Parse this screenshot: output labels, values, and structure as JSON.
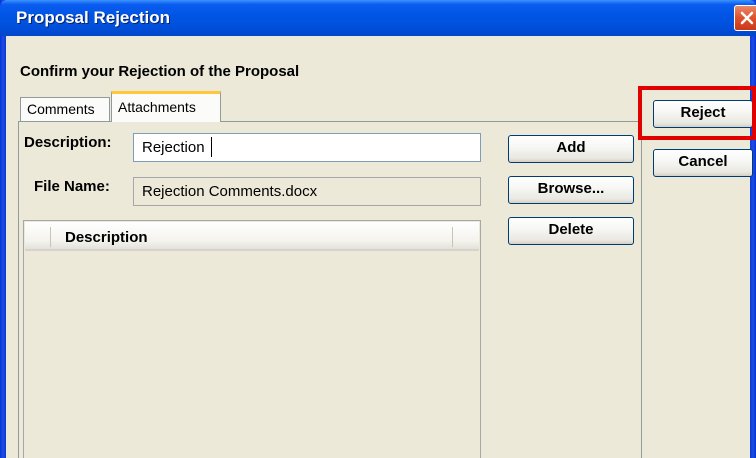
{
  "window": {
    "title": "Proposal Rejection",
    "heading": "Confirm your Rejection of the Proposal",
    "close_icon": "close-icon",
    "title_color": "#0054e3"
  },
  "tabs": [
    {
      "label": "Comments",
      "active": false
    },
    {
      "label": "Attachments",
      "active": true
    }
  ],
  "form": {
    "description_label": "Description:",
    "description_value": "Rejection",
    "filename_label": "File Name:",
    "filename_value": "Rejection Comments.docx"
  },
  "buttons": {
    "add": "Add",
    "browse": "Browse...",
    "delete": "Delete",
    "reject": "Reject",
    "cancel": "Cancel"
  },
  "list": {
    "columns": [
      "Description"
    ],
    "rows": []
  },
  "highlight_color": "#e00000"
}
